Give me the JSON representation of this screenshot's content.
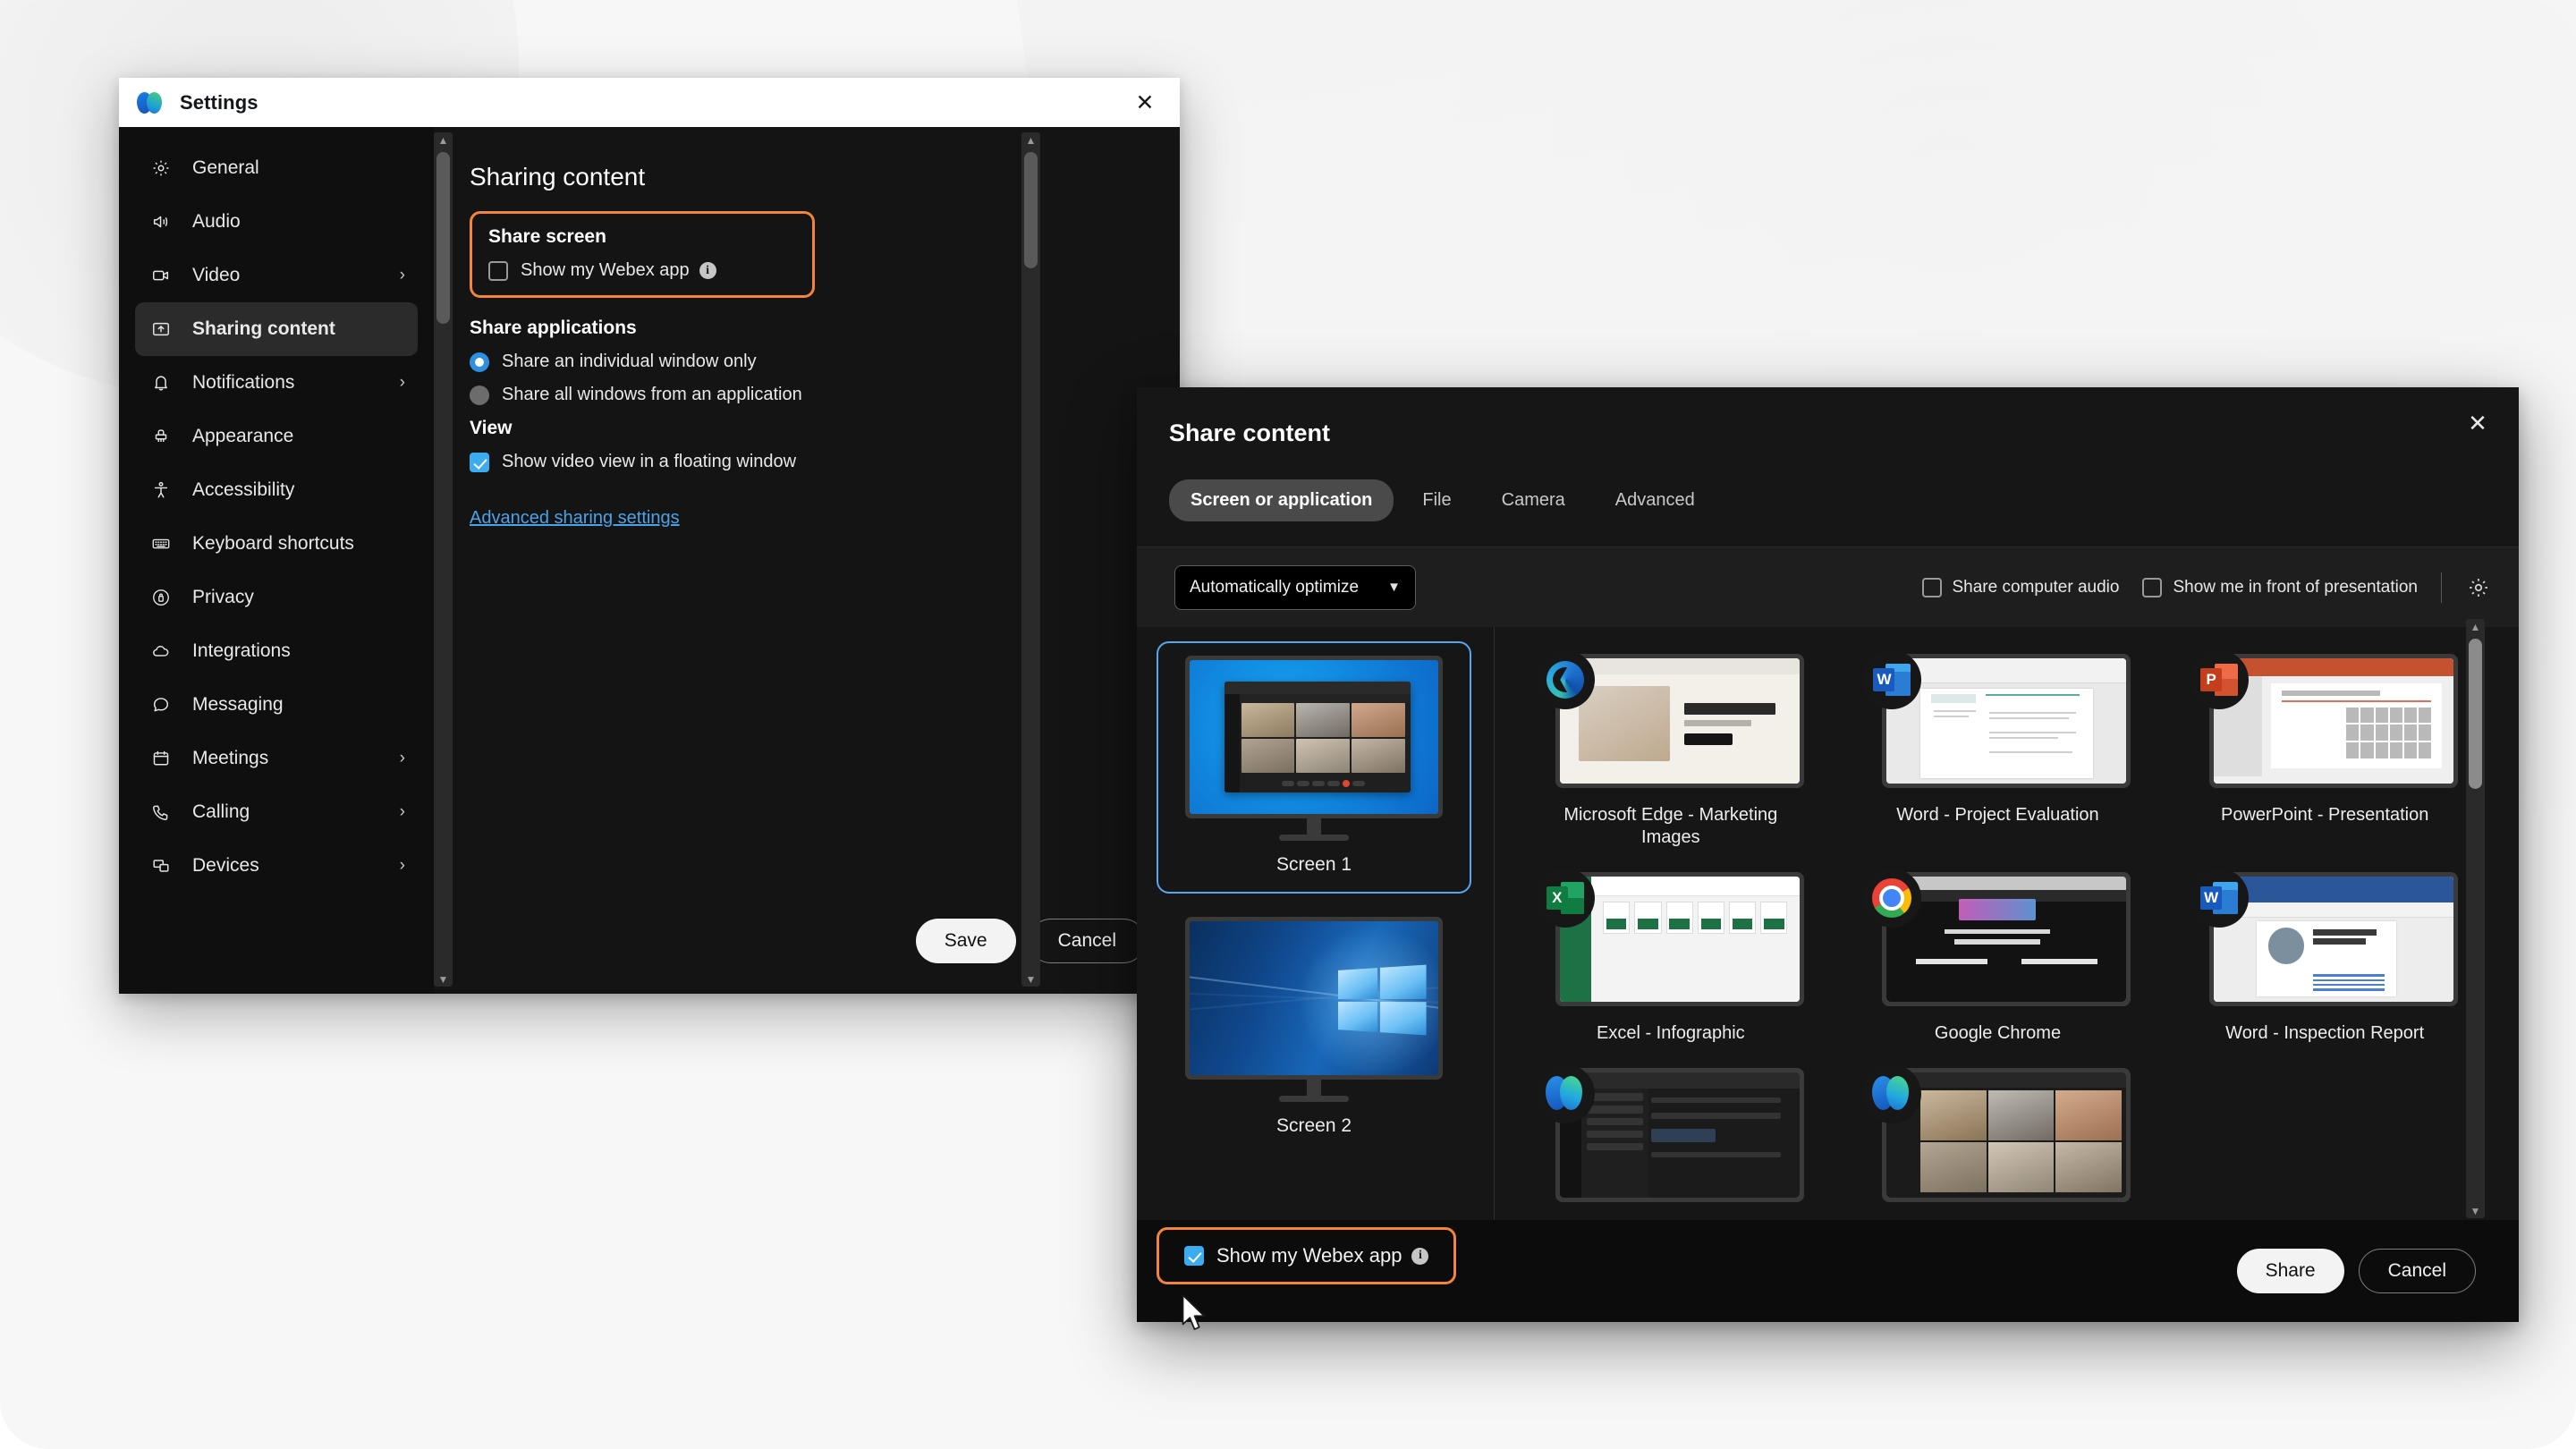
{
  "settings_window": {
    "title": "Settings",
    "logo_icon": "webex-logo",
    "close_icon": "close-icon",
    "sidebar": {
      "items": [
        {
          "label": "General",
          "icon": "gear-icon",
          "chevron": "",
          "active": false
        },
        {
          "label": "Audio",
          "icon": "speaker-icon",
          "chevron": "",
          "active": false
        },
        {
          "label": "Video",
          "icon": "camera-icon",
          "chevron": "›",
          "active": false
        },
        {
          "label": "Sharing content",
          "icon": "share-icon",
          "chevron": "",
          "active": true
        },
        {
          "label": "Notifications",
          "icon": "bell-icon",
          "chevron": "›",
          "active": false
        },
        {
          "label": "Appearance",
          "icon": "paintbrush-icon",
          "chevron": "",
          "active": false
        },
        {
          "label": "Accessibility",
          "icon": "accessibility-icon",
          "chevron": "",
          "active": false
        },
        {
          "label": "Keyboard shortcuts",
          "icon": "keyboard-icon",
          "chevron": "",
          "active": false
        },
        {
          "label": "Privacy",
          "icon": "lock-icon",
          "chevron": "",
          "active": false
        },
        {
          "label": "Integrations",
          "icon": "cloud-icon",
          "chevron": "",
          "active": false
        },
        {
          "label": "Messaging",
          "icon": "chat-icon",
          "chevron": "",
          "active": false
        },
        {
          "label": "Meetings",
          "icon": "calendar-icon",
          "chevron": "›",
          "active": false
        },
        {
          "label": "Calling",
          "icon": "phone-icon",
          "chevron": "›",
          "active": false
        },
        {
          "label": "Devices",
          "icon": "devices-icon",
          "chevron": "›",
          "active": false
        }
      ]
    },
    "content": {
      "heading": "Sharing content",
      "share_screen": {
        "label": "Share screen",
        "highlighted": true,
        "highlight_color": "#f2843c",
        "show_webex_app": {
          "label": "Show my Webex app",
          "checked": false,
          "info_icon": "info-icon"
        }
      },
      "share_applications": {
        "label": "Share applications",
        "options": [
          {
            "label": "Share an individual window only",
            "selected": true
          },
          {
            "label": "Share all windows from an application",
            "selected": false
          }
        ]
      },
      "view": {
        "label": "View",
        "floating_window": {
          "label": "Show video view in a floating window",
          "checked": true
        }
      },
      "advanced_link": "Advanced sharing settings"
    },
    "footer": {
      "save_label": "Save",
      "cancel_label": "Cancel"
    }
  },
  "share_dialog": {
    "title": "Share content",
    "close_icon": "close-icon",
    "tabs": [
      {
        "label": "Screen or application",
        "active": true
      },
      {
        "label": "File",
        "active": false
      },
      {
        "label": "Camera",
        "active": false
      },
      {
        "label": "Advanced",
        "active": false
      }
    ],
    "toolbar": {
      "optimize_select": {
        "value": "Automatically optimize",
        "chevron_icon": "chevron-down-icon"
      },
      "share_computer_audio": {
        "label": "Share computer audio",
        "checked": false
      },
      "show_me_in_front": {
        "label": "Show me in front of presentation",
        "checked": false
      },
      "settings_gear_icon": "gear-icon"
    },
    "screens": [
      {
        "label": "Screen 1",
        "selected": true,
        "thumb": "webex-meeting-on-blue-desktop"
      },
      {
        "label": "Screen 2",
        "selected": false,
        "thumb": "windows-10-wallpaper"
      }
    ],
    "applications": [
      {
        "name": "Microsoft Edge - Marketing Images",
        "icon": "edge-icon",
        "thumb": "edge-marketing-page"
      },
      {
        "name": "Word - Project Evaluation",
        "icon": "word-icon",
        "thumb": "word-resume-document"
      },
      {
        "name": "PowerPoint - Presentation",
        "icon": "powerpoint-icon",
        "thumb": "powerpoint-3d-models-slide"
      },
      {
        "name": "Excel - Infographic",
        "icon": "excel-icon",
        "thumb": "excel-start-screen"
      },
      {
        "name": "Google Chrome",
        "icon": "chrome-icon",
        "thumb": "chrome-10x-webpage"
      },
      {
        "name": "Word - Inspection Report",
        "icon": "word-icon",
        "thumb": "word-name-here-resume"
      },
      {
        "name": "",
        "icon": "webex-icon",
        "thumb": "webex-messaging-space"
      },
      {
        "name": "",
        "icon": "webex-icon",
        "thumb": "webex-video-grid"
      }
    ],
    "footer": {
      "show_webex_app": {
        "label": "Show my Webex app",
        "checked": true,
        "highlighted": true,
        "highlight_color": "#f2843c",
        "info_icon": "info-icon"
      },
      "share_label": "Share",
      "cancel_label": "Cancel"
    }
  }
}
